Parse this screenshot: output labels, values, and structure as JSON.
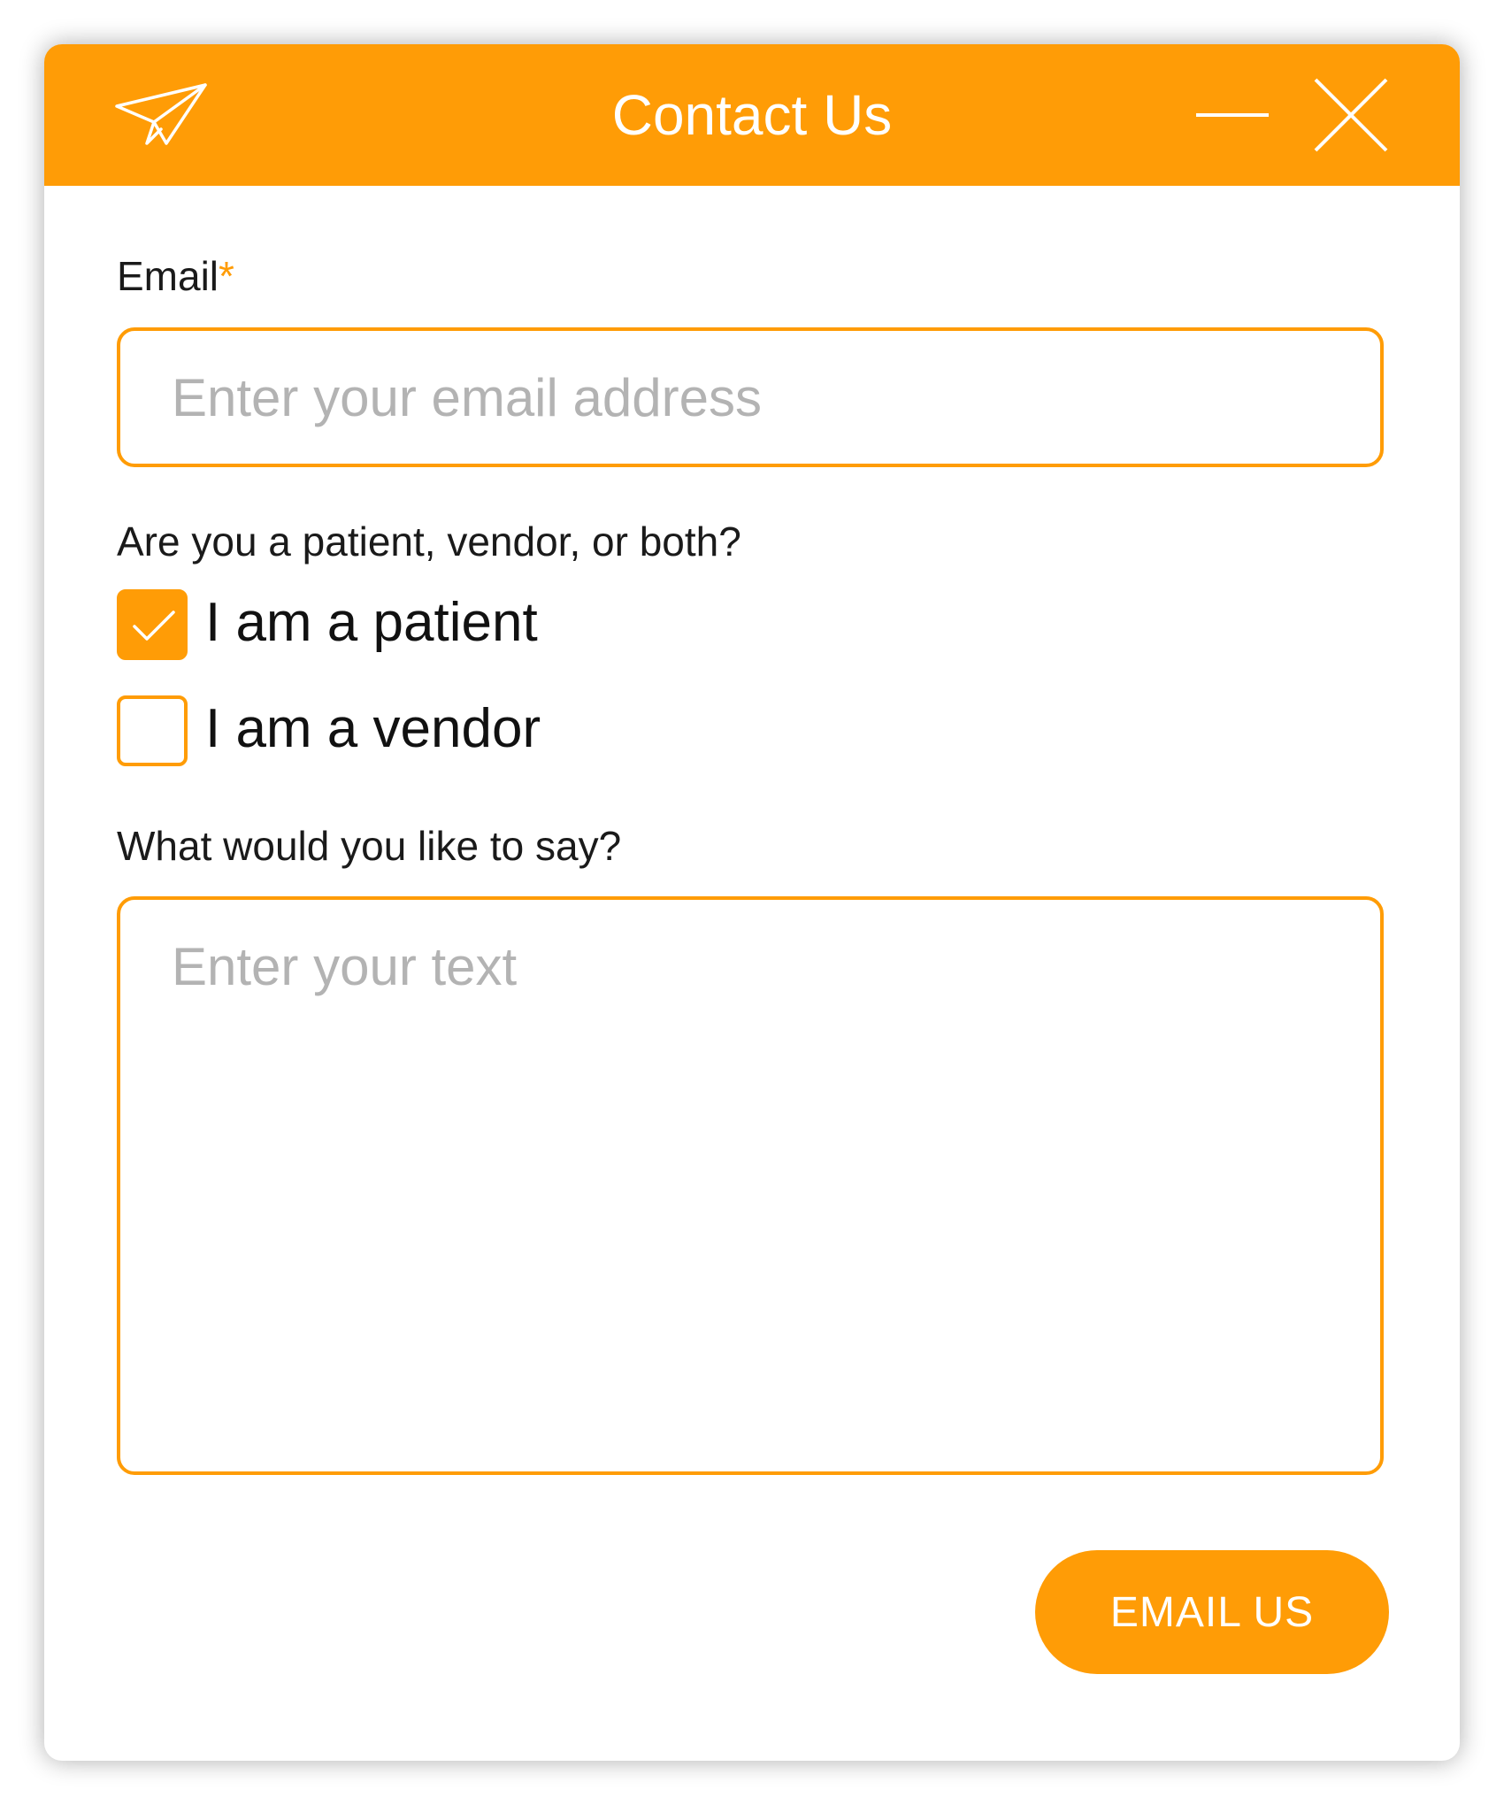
{
  "dialog": {
    "title": "Contact Us",
    "header_icon": "paper-plane-icon",
    "minimize_icon": "minimize-icon",
    "close_icon": "close-icon",
    "accent_color": "#FF9C06"
  },
  "form": {
    "email": {
      "label": "Email",
      "required_mark": "*",
      "placeholder": "Enter your email address",
      "value": ""
    },
    "role_question": "Are you a patient, vendor, or both?",
    "options": [
      {
        "label": "I am a patient",
        "checked": true
      },
      {
        "label": "I am a vendor",
        "checked": false
      }
    ],
    "message": {
      "label": "What would you like to say?",
      "placeholder": "Enter your text",
      "value": ""
    },
    "submit_label": "EMAIL US"
  }
}
